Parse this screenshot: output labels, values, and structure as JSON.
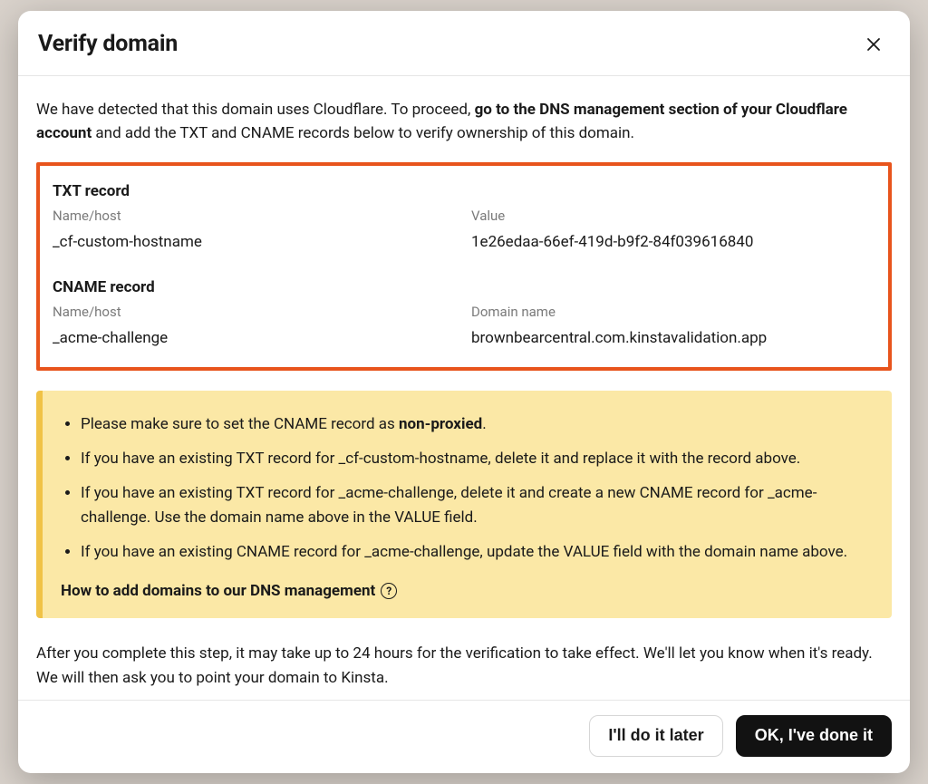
{
  "modal": {
    "title": "Verify domain",
    "intro_lead": "We have detected that this domain uses Cloudflare. To proceed, ",
    "intro_bold": "go to the DNS management section of your Cloudflare account",
    "intro_tail": " and add the TXT and CNAME records below to verify ownership of this domain."
  },
  "records": {
    "txt": {
      "heading": "TXT record",
      "name_label": "Name/host",
      "name_value": "_cf-custom-hostname",
      "value_label": "Value",
      "value_value": "1e26edaa-66ef-419d-b9f2-84f039616840"
    },
    "cname": {
      "heading": "CNAME record",
      "name_label": "Name/host",
      "name_value": "_acme-challenge",
      "value_label": "Domain name",
      "value_value": "brownbearcentral.com.kinstavalidation.app"
    }
  },
  "notes": {
    "item1_pre": "Please make sure to set the CNAME record as ",
    "item1_bold": "non-proxied",
    "item1_post": ".",
    "item2": "If you have an existing TXT record for _cf-custom-hostname, delete it and replace it with the record above.",
    "item3": "If you have an existing TXT record for _acme-challenge, delete it and create a new CNAME record for _acme-challenge. Use the domain name above in the VALUE field.",
    "item4": "If you have an existing CNAME record for _acme-challenge, update the VALUE field with the domain name above.",
    "help_link": "How to add domains to our DNS management"
  },
  "outro": "After you complete this step, it may take up to 24 hours for the verification to take effect. We'll let you know when it's ready. We will then ask you to point your domain to Kinsta.",
  "footer": {
    "secondary": "I'll do it later",
    "primary": "OK, I've done it"
  }
}
